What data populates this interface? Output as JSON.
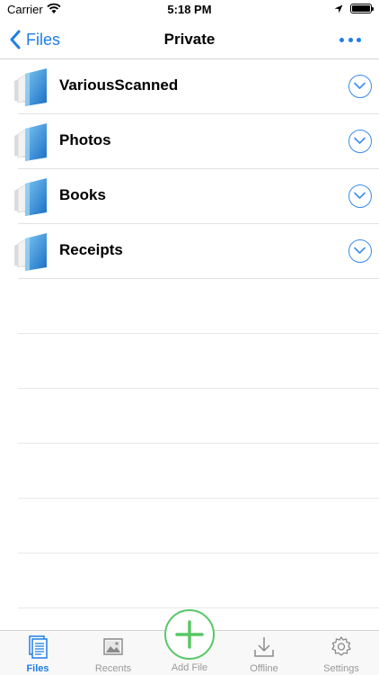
{
  "status_bar": {
    "carrier": "Carrier",
    "time": "5:18 PM"
  },
  "nav": {
    "back_label": "Files",
    "title": "Private"
  },
  "folders": [
    {
      "label": "VariousScanned"
    },
    {
      "label": "Photos"
    },
    {
      "label": "Books"
    },
    {
      "label": "Receipts"
    }
  ],
  "tabs": [
    {
      "label": "Files",
      "icon": "files-icon",
      "active": true
    },
    {
      "label": "Recents",
      "icon": "photos-icon",
      "active": false
    },
    {
      "label": "Add File",
      "icon": "plus-icon",
      "active": false
    },
    {
      "label": "Offline",
      "icon": "download-icon",
      "active": false
    },
    {
      "label": "Settings",
      "icon": "gear-icon",
      "active": false
    }
  ],
  "colors": {
    "accent": "#1f7ee8",
    "add_green": "#58c766",
    "chevron_blue": "#3a8ce8"
  }
}
